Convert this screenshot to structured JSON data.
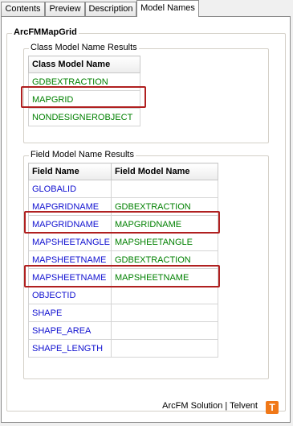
{
  "tabs": [
    "Contents",
    "Preview",
    "Description",
    "Model Names"
  ],
  "active_tab": "Model Names",
  "object_name": "ArcFMMapGrid",
  "class_section": {
    "title": "Class Model Name Results",
    "header": "Class Model Name",
    "rows": [
      "GDBEXTRACTION",
      "MAPGRID",
      "NONDESIGNEROBJECT"
    ]
  },
  "field_section": {
    "title": "Field Model Name Results",
    "headers": [
      "Field Name",
      "Field Model Name"
    ],
    "rows": [
      [
        "GLOBALID",
        ""
      ],
      [
        "MAPGRIDNAME",
        "GDBEXTRACTION"
      ],
      [
        "MAPGRIDNAME",
        "MAPGRIDNAME"
      ],
      [
        "MAPSHEETANGLE",
        "MAPSHEETANGLE"
      ],
      [
        "MAPSHEETNAME",
        "GDBEXTRACTION"
      ],
      [
        "MAPSHEETNAME",
        "MAPSHEETNAME"
      ],
      [
        "OBJECTID",
        ""
      ],
      [
        "SHAPE",
        ""
      ],
      [
        "SHAPE_AREA",
        ""
      ],
      [
        "SHAPE_LENGTH",
        ""
      ]
    ]
  },
  "footer": {
    "text": "ArcFM Solution | Telvent",
    "logo": "T"
  },
  "colors": {
    "class_text": "#008000",
    "field_text": "#1010d0",
    "highlight": "#b02020"
  }
}
